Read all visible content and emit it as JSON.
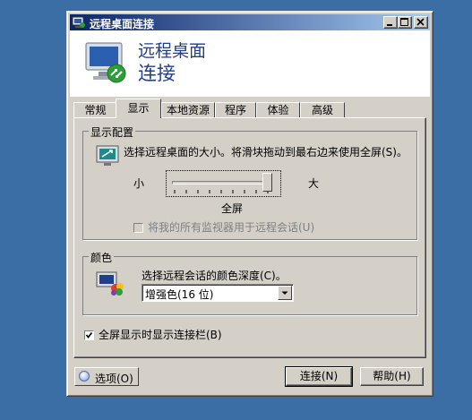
{
  "window": {
    "title": "远程桌面连接"
  },
  "banner": {
    "line1": "远程桌面",
    "line2": "连接"
  },
  "tabs": [
    {
      "label": "常规",
      "active": false
    },
    {
      "label": "显示",
      "active": true
    },
    {
      "label": "本地资源",
      "active": false
    },
    {
      "label": "程序",
      "active": false
    },
    {
      "label": "体验",
      "active": false
    },
    {
      "label": "高级",
      "active": false
    }
  ],
  "display": {
    "group_label": "显示配置",
    "description": "选择远程桌面的大小。将滑块拖动到最右边来使用全屏(S)。",
    "small_label": "小",
    "large_label": "大",
    "slider_caption": "全屏",
    "slider_value_fraction": 1.0,
    "multi_monitor_label": "将我的所有监视器用于远程会话(U)"
  },
  "colors": {
    "group_label": "颜色",
    "description": "选择远程会话的颜色深度(C)。",
    "depth_value": "增强色(16 位)"
  },
  "fullscreen_bar": {
    "label": "全屏显示时显示连接栏(B)",
    "checked": true
  },
  "footer": {
    "options_label": "选项(O)",
    "connect_label": "连接(N)",
    "help_label": "帮助(H)"
  },
  "colors_ui": {
    "titlebar_start": "#0a246a",
    "titlebar_end": "#a6caf0",
    "desktop": "#3a6ea5",
    "dialog": "#d4d0c8",
    "banner_text": "#1e3f8c"
  }
}
